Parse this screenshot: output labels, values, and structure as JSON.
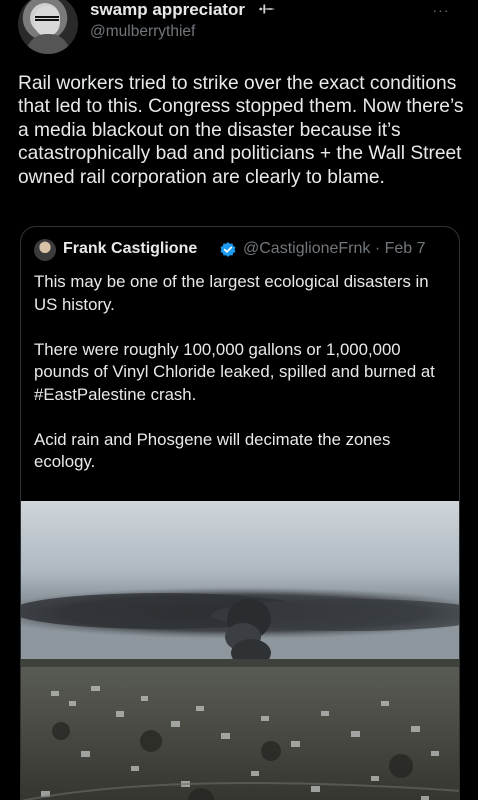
{
  "tweet": {
    "display_name": "swamp appreciator",
    "handle": "@mulberrythief",
    "badge_icon": "dagger-icon",
    "more_icon": "ellipsis-icon",
    "more_label": "···",
    "text": "Rail workers tried to strike over the exact conditions that led to this. Congress stopped them. Now there’s a media blackout on the disaster because it’s catastrophically bad and politicians + the Wall Street owned rail corporation are clearly to blame."
  },
  "quote": {
    "display_name": "Frank Castiglione",
    "verified_icon": "verified-badge-icon",
    "verified_color": "#1d9bf0",
    "handle_date": "@CastiglioneFrnk · Feb 7",
    "paragraphs": [
      "This may be one of the largest ecological disasters in US history.",
      "There were roughly 100,000 gallons or 1,000,000 pounds of Vinyl Chloride leaked, spilled and burned at #EastPalestine crash.",
      "Acid rain and Phosgene will decimate the zones ecology."
    ],
    "photo_subject": "aerial-photo-smoke-plume-over-town"
  },
  "colors": {
    "background": "#000000",
    "text": "#e7e9ea",
    "secondary_text": "#71767b",
    "border": "#2f3336"
  }
}
